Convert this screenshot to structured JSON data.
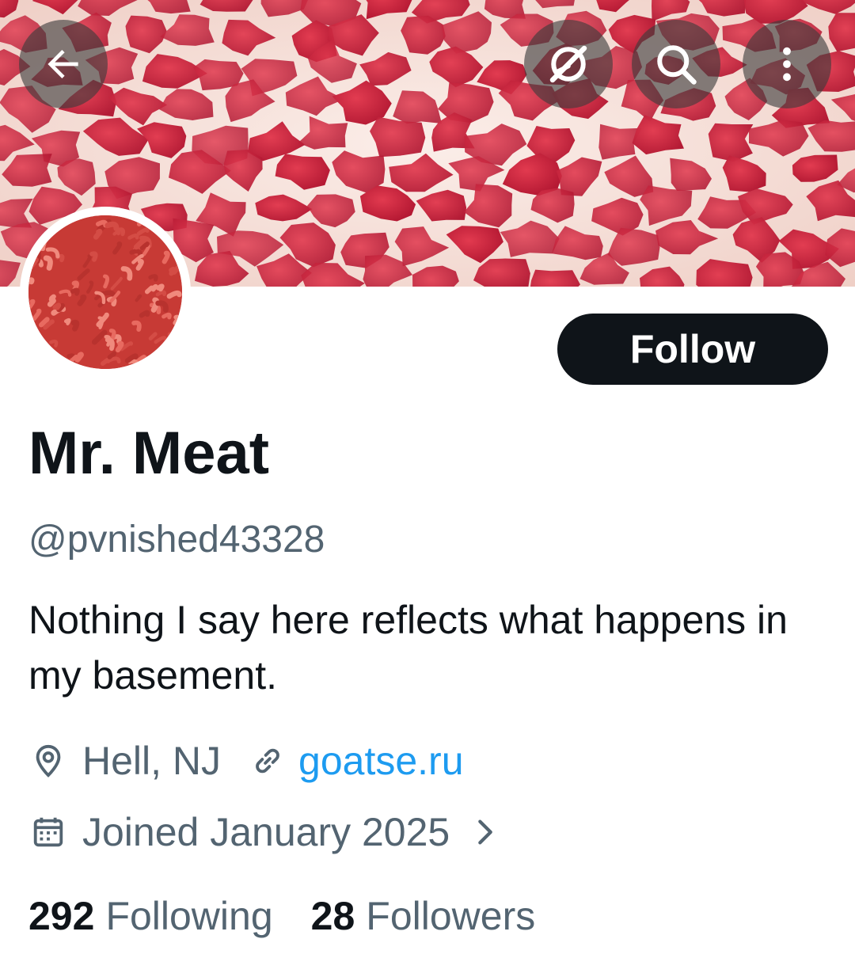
{
  "header": {
    "back_icon": "arrow-left-icon",
    "grok_icon": "grok-icon",
    "search_icon": "search-icon",
    "more_icon": "more-vertical-icon",
    "banner_image": "marbled-meat-banner",
    "avatar_image": "ground-meat-avatar"
  },
  "profile": {
    "follow_label": "Follow",
    "display_name": "Mr. Meat",
    "handle": "@pvnished43328",
    "bio": "Nothing I say here reflects what happens in my basement.",
    "location": "Hell, NJ",
    "website": "goatse.ru",
    "joined": "Joined January 2025"
  },
  "stats": {
    "following_count": "292",
    "following_label": "Following",
    "followers_count": "28",
    "followers_label": "Followers"
  },
  "colors": {
    "text_primary": "#0f1419",
    "text_secondary": "#536471",
    "link": "#1d9bf0",
    "button_bg": "#0f1419"
  }
}
